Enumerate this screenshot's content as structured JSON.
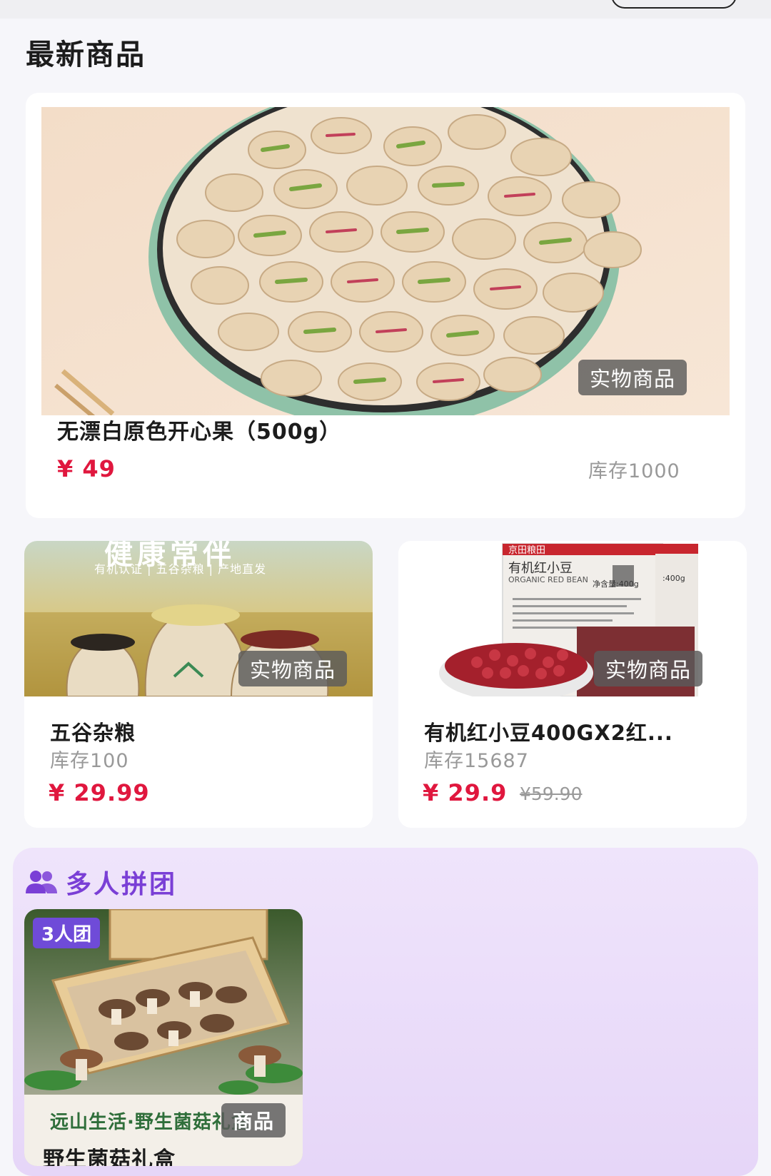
{
  "section": {
    "title": "最新商品"
  },
  "featured": {
    "badge": "实物商品",
    "name": "无漂白原色开心果（500g）",
    "price": "¥ 49",
    "stock": "库存1000"
  },
  "grid": [
    {
      "banner_title": "健康常伴",
      "banner_tags": "有机认证 | 五谷杂粮 | 产地直发",
      "badge": "实物商品",
      "name": "五谷杂粮",
      "stock": "库存100",
      "price": "¥ 29.99",
      "original_price": ""
    },
    {
      "package_brand": "京田粮田",
      "package_title": "有机红小豆",
      "package_subtitle": "ORGANIC RED BEAN",
      "package_weight": "净含量:400g",
      "package_weight_2": ":400g",
      "badge": "实物商品",
      "name": "有机红小豆400GX2红...",
      "stock": "库存15687",
      "price": "¥ 29.9",
      "original_price": "¥59.90"
    }
  ],
  "group_buy": {
    "title": "多人拼团",
    "item": {
      "team_size": "3人团",
      "overlay_text": "远山生活·野生菌菇礼盒",
      "badge": "商品",
      "name": "野生菌菇礼盒"
    }
  },
  "colors": {
    "price": "#e0173e",
    "group_accent": "#7a3fd6",
    "group_bg": "#e9dcf9"
  }
}
